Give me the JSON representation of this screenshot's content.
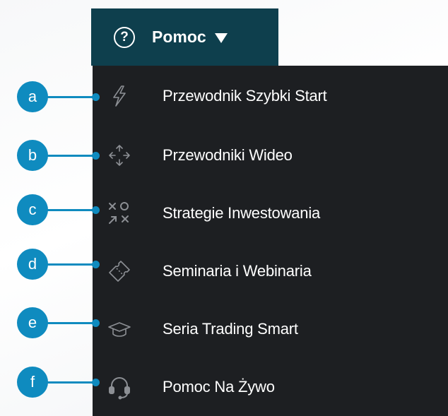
{
  "help_button": {
    "question_glyph": "?",
    "label": "Pomoc",
    "icon": "question-circle-icon",
    "caret_icon": "caret-down-icon",
    "background": "#0e3f4d"
  },
  "menu": {
    "background": "#1d1f22",
    "items": [
      {
        "label": "Przewodnik Szybki Start",
        "icon": "lightning-icon"
      },
      {
        "label": "Przewodniki Wideo",
        "icon": "move-arrows-icon"
      },
      {
        "label": "Strategie Inwestowania",
        "icon": "strategy-icon"
      },
      {
        "label": "Seminaria i Webinaria",
        "icon": "ticket-icon"
      },
      {
        "label": "Seria Trading Smart",
        "icon": "graduation-cap-icon"
      },
      {
        "label": "Pomoc Na Żywo",
        "icon": "headset-icon"
      }
    ]
  },
  "callouts": {
    "color": "#0f8bbf",
    "letters": [
      "a",
      "b",
      "c",
      "d",
      "e",
      "f"
    ]
  }
}
